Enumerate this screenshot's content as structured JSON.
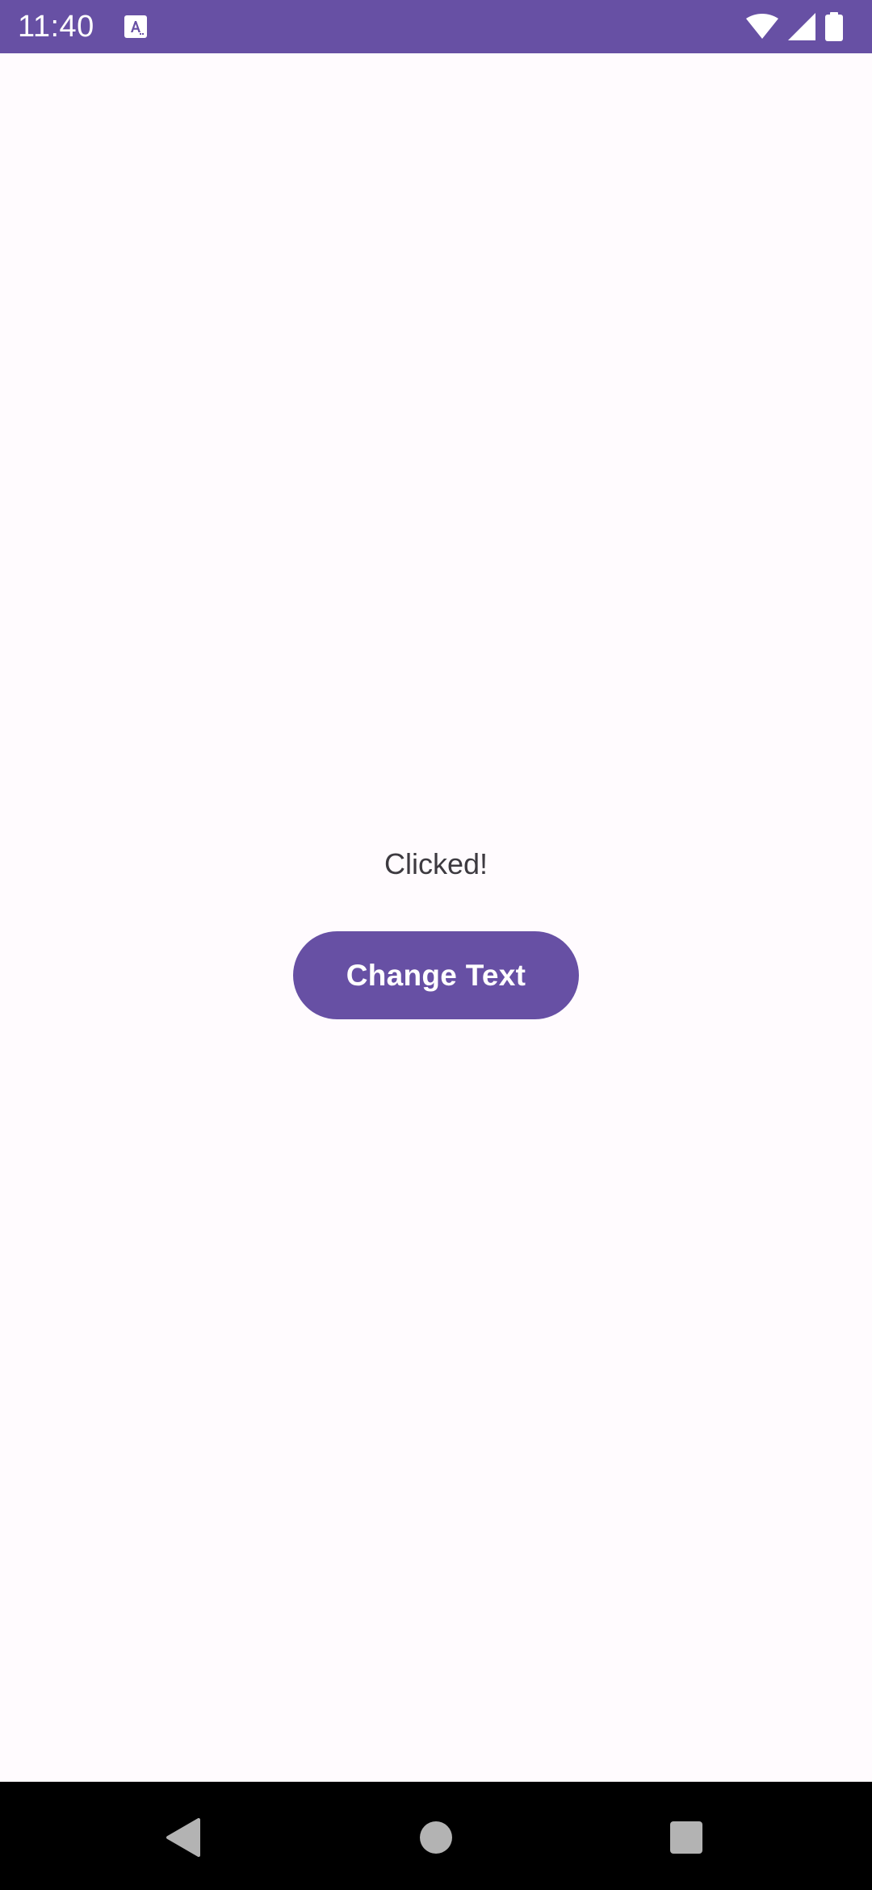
{
  "status_bar": {
    "time": "11:40",
    "background": "#6750A4",
    "icons": [
      "font-notification-icon",
      "wifi-icon",
      "signal-icon",
      "battery-icon"
    ]
  },
  "main": {
    "message": "Clicked!",
    "button_label": "Change Text",
    "accent": "#6750A4"
  },
  "nav_bar": {
    "icons": [
      "back-icon",
      "home-icon",
      "recents-icon"
    ]
  }
}
